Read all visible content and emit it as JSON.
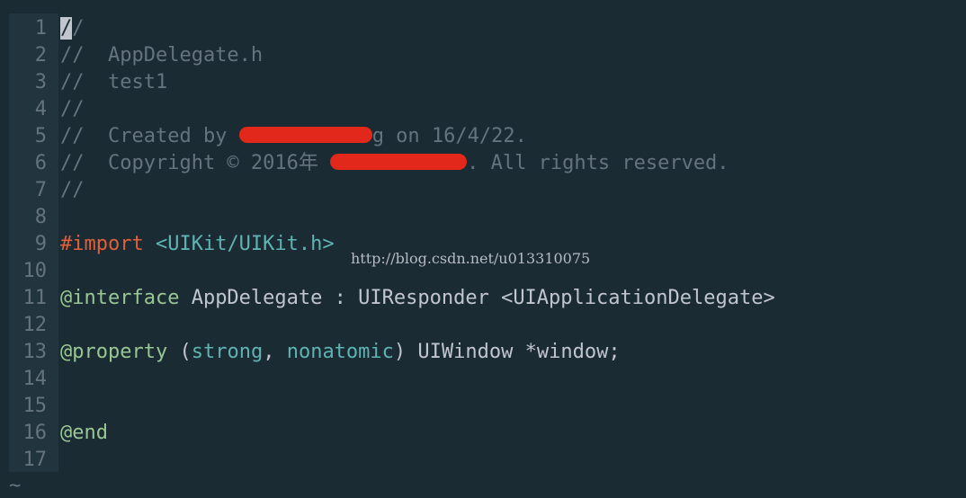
{
  "editor": {
    "lines": [
      {
        "n": "1",
        "parts": [
          [
            "cursor",
            "/"
          ],
          [
            "comment",
            "/"
          ]
        ]
      },
      {
        "n": "2",
        "parts": [
          [
            "comment",
            "//  AppDelegate.h"
          ]
        ]
      },
      {
        "n": "3",
        "parts": [
          [
            "comment",
            "//  test1"
          ]
        ]
      },
      {
        "n": "4",
        "parts": [
          [
            "comment",
            "//"
          ]
        ]
      },
      {
        "n": "5",
        "parts": [
          [
            "comment",
            "//  Created by "
          ],
          [
            "redact",
            ""
          ],
          [
            "comment",
            "g on 16/4/22."
          ]
        ]
      },
      {
        "n": "6",
        "parts": [
          [
            "comment",
            "//  Copyright © 2016年 "
          ],
          [
            "redact",
            ""
          ],
          [
            "comment",
            ". All rights reserved."
          ]
        ]
      },
      {
        "n": "7",
        "parts": [
          [
            "comment",
            "//"
          ]
        ]
      },
      {
        "n": "8",
        "parts": []
      },
      {
        "n": "9",
        "parts": [
          [
            "kw-red",
            "#import"
          ],
          [
            "plain",
            " "
          ],
          [
            "str",
            "<UIKit/UIKit.h>"
          ]
        ]
      },
      {
        "n": "10",
        "parts": []
      },
      {
        "n": "11",
        "parts": [
          [
            "kw-green",
            "@interface"
          ],
          [
            "plain",
            " AppDelegate : UIResponder <UIApplicationDelegate>"
          ]
        ]
      },
      {
        "n": "12",
        "parts": []
      },
      {
        "n": "13",
        "parts": [
          [
            "kw-green",
            "@property"
          ],
          [
            "plain",
            " ("
          ],
          [
            "type",
            "strong"
          ],
          [
            "plain",
            ", "
          ],
          [
            "type",
            "nonatomic"
          ],
          [
            "plain",
            ") UIWindow *window;"
          ]
        ]
      },
      {
        "n": "14",
        "parts": []
      },
      {
        "n": "15",
        "parts": []
      },
      {
        "n": "16",
        "parts": [
          [
            "kw-green",
            "@end"
          ]
        ]
      },
      {
        "n": "17",
        "parts": []
      }
    ],
    "tilde": "~"
  },
  "watermark": "http://blog.csdn.net/u013310075",
  "colors": {
    "background": "#1b2b34",
    "gutter": "#22343e",
    "comment": "#65737e",
    "keyword_red": "#e0603a",
    "keyword_green": "#99c794",
    "string": "#5fb3b3",
    "text": "#c0c5ce",
    "redaction": "#e1281a"
  }
}
